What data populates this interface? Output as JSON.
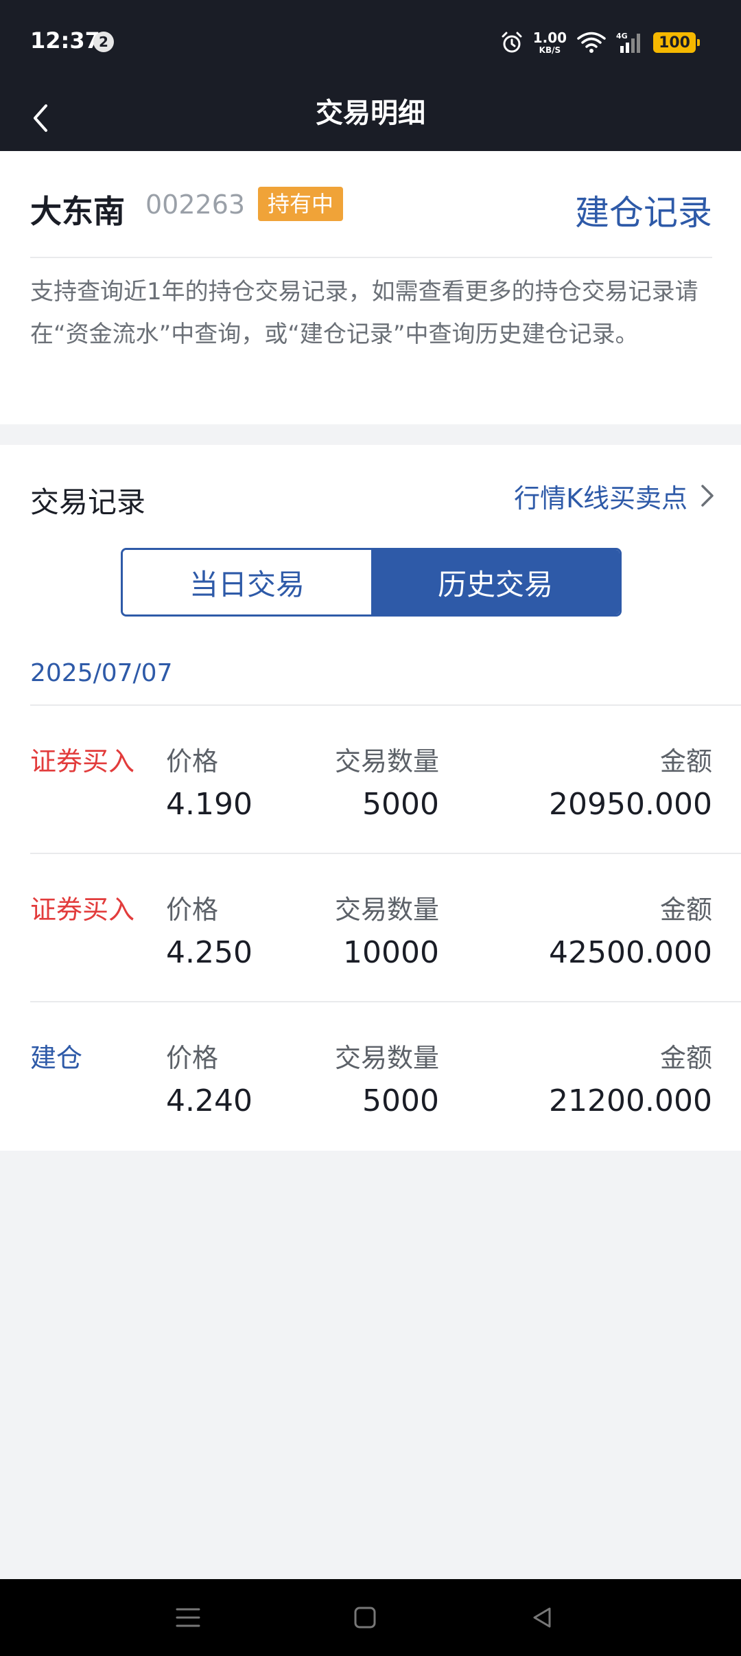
{
  "status_bar": {
    "time": "12:37",
    "notification_count": "2",
    "net_speed": "1.00",
    "net_speed_unit": "KB/S",
    "network_type": "4G",
    "battery": "100"
  },
  "header": {
    "title": "交易明细",
    "back_icon": "chevron-left-icon"
  },
  "stock": {
    "name": "大东南",
    "code": "002263",
    "status_badge": "持有中",
    "open_record_link": "建仓记录"
  },
  "notice": "支持查询近1年的持仓交易记录，如需查看更多的持仓交易记录请在“资金流水”中查询，或“建仓记录”中查询历史建仓记录。",
  "records": {
    "title": "交易记录",
    "kline_link": "行情K线买卖点",
    "tabs": [
      {
        "label": "当日交易",
        "active": false
      },
      {
        "label": "历史交易",
        "active": true
      }
    ],
    "date": "2025/07/07",
    "columns": {
      "price": "价格",
      "quantity": "交易数量",
      "amount": "金额"
    },
    "rows": [
      {
        "type": "证券买入",
        "kind": "buy",
        "price": "4.190",
        "quantity": "5000",
        "amount": "20950.000"
      },
      {
        "type": "证券买入",
        "kind": "buy",
        "price": "4.250",
        "quantity": "10000",
        "amount": "42500.000"
      },
      {
        "type": "建仓",
        "kind": "open",
        "price": "4.240",
        "quantity": "5000",
        "amount": "21200.000"
      }
    ]
  },
  "colors": {
    "accent": "#2e5aa8",
    "buy": "#e23c3c",
    "badge": "#f0a338",
    "header_bg": "#1a1d26"
  },
  "nav": {
    "icons": [
      "menu-icon",
      "home-icon",
      "back-icon"
    ]
  }
}
